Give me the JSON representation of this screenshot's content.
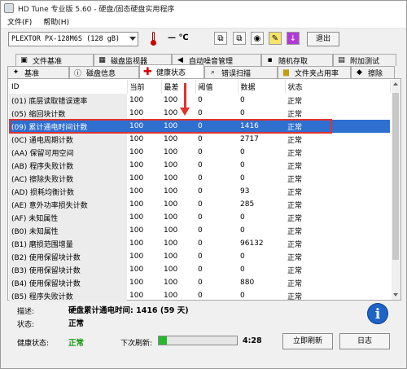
{
  "app": {
    "title": "HD Tune 专业版 5.60 - 硬盘/固态硬盘实用程序"
  },
  "menu": [
    "文件(F)",
    "帮助(H)"
  ],
  "toolbar": {
    "drive": "PLEXTOR PX-128M6S (128 gB)",
    "temperature": "— ℃",
    "exit_label": "退出"
  },
  "tabs_row1": [
    "文件基准",
    "磁盘监视器",
    "自动噪音管理",
    "随机存取",
    "附加测试"
  ],
  "tabs_row2": [
    "基准",
    "磁盘信息",
    "健康状态",
    "错误扫描",
    "文件夹占用率",
    "擦除"
  ],
  "columns": [
    "ID",
    "当前",
    "最差",
    "阈值",
    "数据",
    "状态"
  ],
  "rows": [
    [
      "(01) 底层读取错误速率",
      "100",
      "100",
      "0",
      "0",
      "正常"
    ],
    [
      "(05) 缩回块计数",
      "100",
      "100",
      "0",
      "0",
      "正常"
    ],
    [
      "(09) 累计通电时间计数",
      "100",
      "100",
      "0",
      "1416",
      "正常"
    ],
    [
      "(0C) 通电周期计数",
      "100",
      "100",
      "0",
      "2717",
      "正常"
    ],
    [
      "(AA) 保留可用空间",
      "100",
      "100",
      "0",
      "0",
      "正常"
    ],
    [
      "(AB) 程序失败计数",
      "100",
      "100",
      "0",
      "0",
      "正常"
    ],
    [
      "(AC) 擦除失败计数",
      "100",
      "100",
      "0",
      "0",
      "正常"
    ],
    [
      "(AD) 损耗均衡计数",
      "100",
      "100",
      "0",
      "93",
      "正常"
    ],
    [
      "(AE) 意外功率损失计数",
      "100",
      "100",
      "0",
      "285",
      "正常"
    ],
    [
      "(AF) 未知属性",
      "100",
      "100",
      "0",
      "0",
      "正常"
    ],
    [
      "(B0) 未知属性",
      "100",
      "100",
      "0",
      "0",
      "正常"
    ],
    [
      "(B1) 磨损范围增量",
      "100",
      "100",
      "0",
      "96132",
      "正常"
    ],
    [
      "(B2) 使用保留块计数",
      "100",
      "100",
      "0",
      "0",
      "正常"
    ],
    [
      "(B3) 使用保留块计数",
      "100",
      "100",
      "0",
      "0",
      "正常"
    ],
    [
      "(B4) 使用保留块计数",
      "100",
      "100",
      "0",
      "880",
      "正常"
    ],
    [
      "(B5) 程序失败计数",
      "100",
      "100",
      "0",
      "0",
      "正常"
    ]
  ],
  "selected_row": 2,
  "footer": {
    "desc_label": "描述:",
    "desc_value": "硬盘累计通电时间: 1416 (59 天)",
    "status_label": "状态:",
    "status_value": "正常",
    "health_label": "健康状态:",
    "health_value": "正常",
    "next_label": "下次刷新:",
    "next_time": "4:28",
    "refresh_label": "立即刷新",
    "log_label": "日志",
    "progress": 0.1
  },
  "colors": {
    "accent": "#2f6fd0",
    "highlight": "#e0322d",
    "ok": "#1a9a1a"
  }
}
